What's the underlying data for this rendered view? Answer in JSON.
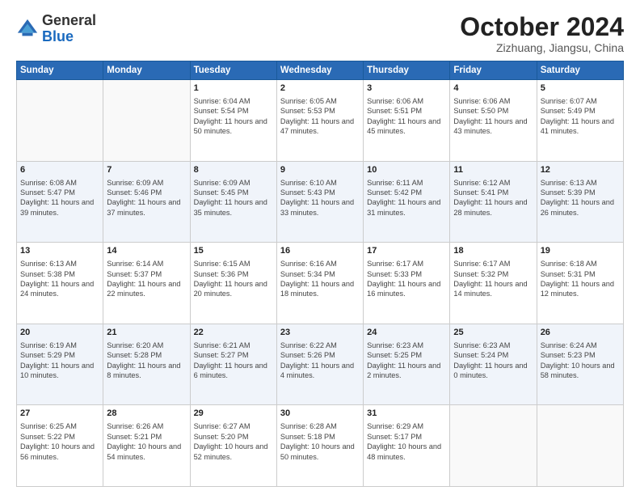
{
  "header": {
    "logo_general": "General",
    "logo_blue": "Blue",
    "month": "October 2024",
    "location": "Zizhuang, Jiangsu, China"
  },
  "days_of_week": [
    "Sunday",
    "Monday",
    "Tuesday",
    "Wednesday",
    "Thursday",
    "Friday",
    "Saturday"
  ],
  "weeks": [
    [
      {
        "day": "",
        "info": ""
      },
      {
        "day": "",
        "info": ""
      },
      {
        "day": "1",
        "info": "Sunrise: 6:04 AM\nSunset: 5:54 PM\nDaylight: 11 hours and 50 minutes."
      },
      {
        "day": "2",
        "info": "Sunrise: 6:05 AM\nSunset: 5:53 PM\nDaylight: 11 hours and 47 minutes."
      },
      {
        "day": "3",
        "info": "Sunrise: 6:06 AM\nSunset: 5:51 PM\nDaylight: 11 hours and 45 minutes."
      },
      {
        "day": "4",
        "info": "Sunrise: 6:06 AM\nSunset: 5:50 PM\nDaylight: 11 hours and 43 minutes."
      },
      {
        "day": "5",
        "info": "Sunrise: 6:07 AM\nSunset: 5:49 PM\nDaylight: 11 hours and 41 minutes."
      }
    ],
    [
      {
        "day": "6",
        "info": "Sunrise: 6:08 AM\nSunset: 5:47 PM\nDaylight: 11 hours and 39 minutes."
      },
      {
        "day": "7",
        "info": "Sunrise: 6:09 AM\nSunset: 5:46 PM\nDaylight: 11 hours and 37 minutes."
      },
      {
        "day": "8",
        "info": "Sunrise: 6:09 AM\nSunset: 5:45 PM\nDaylight: 11 hours and 35 minutes."
      },
      {
        "day": "9",
        "info": "Sunrise: 6:10 AM\nSunset: 5:43 PM\nDaylight: 11 hours and 33 minutes."
      },
      {
        "day": "10",
        "info": "Sunrise: 6:11 AM\nSunset: 5:42 PM\nDaylight: 11 hours and 31 minutes."
      },
      {
        "day": "11",
        "info": "Sunrise: 6:12 AM\nSunset: 5:41 PM\nDaylight: 11 hours and 28 minutes."
      },
      {
        "day": "12",
        "info": "Sunrise: 6:13 AM\nSunset: 5:39 PM\nDaylight: 11 hours and 26 minutes."
      }
    ],
    [
      {
        "day": "13",
        "info": "Sunrise: 6:13 AM\nSunset: 5:38 PM\nDaylight: 11 hours and 24 minutes."
      },
      {
        "day": "14",
        "info": "Sunrise: 6:14 AM\nSunset: 5:37 PM\nDaylight: 11 hours and 22 minutes."
      },
      {
        "day": "15",
        "info": "Sunrise: 6:15 AM\nSunset: 5:36 PM\nDaylight: 11 hours and 20 minutes."
      },
      {
        "day": "16",
        "info": "Sunrise: 6:16 AM\nSunset: 5:34 PM\nDaylight: 11 hours and 18 minutes."
      },
      {
        "day": "17",
        "info": "Sunrise: 6:17 AM\nSunset: 5:33 PM\nDaylight: 11 hours and 16 minutes."
      },
      {
        "day": "18",
        "info": "Sunrise: 6:17 AM\nSunset: 5:32 PM\nDaylight: 11 hours and 14 minutes."
      },
      {
        "day": "19",
        "info": "Sunrise: 6:18 AM\nSunset: 5:31 PM\nDaylight: 11 hours and 12 minutes."
      }
    ],
    [
      {
        "day": "20",
        "info": "Sunrise: 6:19 AM\nSunset: 5:29 PM\nDaylight: 11 hours and 10 minutes."
      },
      {
        "day": "21",
        "info": "Sunrise: 6:20 AM\nSunset: 5:28 PM\nDaylight: 11 hours and 8 minutes."
      },
      {
        "day": "22",
        "info": "Sunrise: 6:21 AM\nSunset: 5:27 PM\nDaylight: 11 hours and 6 minutes."
      },
      {
        "day": "23",
        "info": "Sunrise: 6:22 AM\nSunset: 5:26 PM\nDaylight: 11 hours and 4 minutes."
      },
      {
        "day": "24",
        "info": "Sunrise: 6:23 AM\nSunset: 5:25 PM\nDaylight: 11 hours and 2 minutes."
      },
      {
        "day": "25",
        "info": "Sunrise: 6:23 AM\nSunset: 5:24 PM\nDaylight: 11 hours and 0 minutes."
      },
      {
        "day": "26",
        "info": "Sunrise: 6:24 AM\nSunset: 5:23 PM\nDaylight: 10 hours and 58 minutes."
      }
    ],
    [
      {
        "day": "27",
        "info": "Sunrise: 6:25 AM\nSunset: 5:22 PM\nDaylight: 10 hours and 56 minutes."
      },
      {
        "day": "28",
        "info": "Sunrise: 6:26 AM\nSunset: 5:21 PM\nDaylight: 10 hours and 54 minutes."
      },
      {
        "day": "29",
        "info": "Sunrise: 6:27 AM\nSunset: 5:20 PM\nDaylight: 10 hours and 52 minutes."
      },
      {
        "day": "30",
        "info": "Sunrise: 6:28 AM\nSunset: 5:18 PM\nDaylight: 10 hours and 50 minutes."
      },
      {
        "day": "31",
        "info": "Sunrise: 6:29 AM\nSunset: 5:17 PM\nDaylight: 10 hours and 48 minutes."
      },
      {
        "day": "",
        "info": ""
      },
      {
        "day": "",
        "info": ""
      }
    ]
  ]
}
